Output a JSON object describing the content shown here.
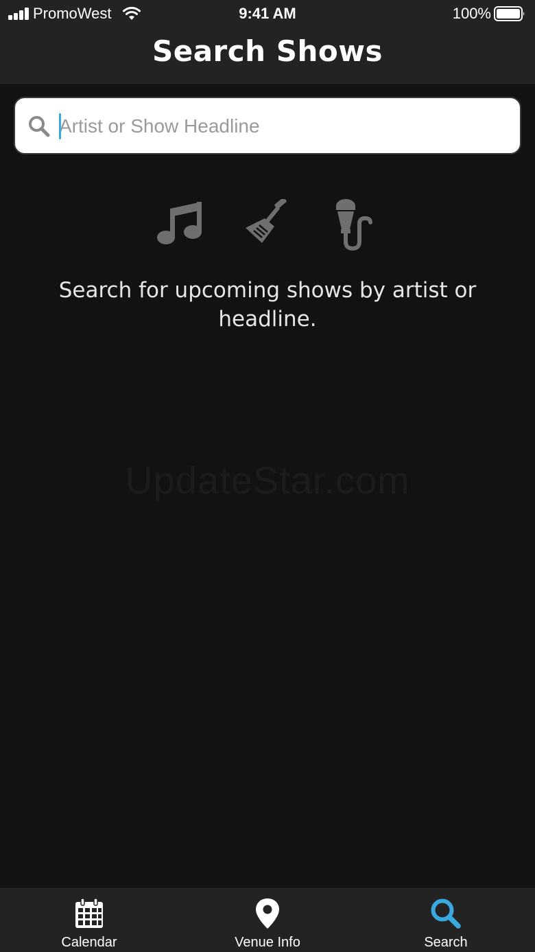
{
  "status_bar": {
    "carrier": "PromoWest",
    "time": "9:41 AM",
    "battery": "100%"
  },
  "header": {
    "title": "Search Shows"
  },
  "search": {
    "placeholder": "Artist or Show Headline",
    "value": ""
  },
  "empty_state": {
    "icons": [
      "music-note-icon",
      "guitar-icon",
      "microphone-icon"
    ],
    "message": "Search for upcoming shows by artist or headline."
  },
  "watermark": "UpdateStar.com",
  "tab_bar": {
    "tabs": [
      {
        "label": "Calendar",
        "icon": "calendar-icon",
        "active": false
      },
      {
        "label": "Venue Info",
        "icon": "map-pin-icon",
        "active": false
      },
      {
        "label": "Search",
        "icon": "search-icon",
        "active": true
      }
    ]
  },
  "colors": {
    "background": "#121212",
    "header_background": "#232323",
    "accent": "#3aa9e0",
    "icon_gray": "#6f6f6f"
  }
}
